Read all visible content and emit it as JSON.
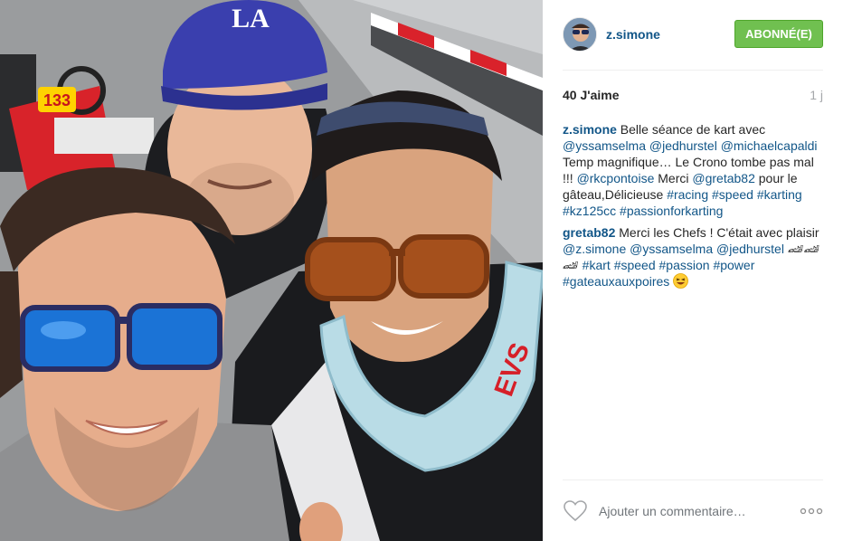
{
  "header": {
    "username": "z.simone",
    "follow_label": "ABONNÉ(E)"
  },
  "stats": {
    "likes": "40 J'aime",
    "time": "1 j"
  },
  "caption": {
    "user": "z.simone",
    "parts": [
      {
        "t": "text",
        "v": " Belle séance de kart avec "
      },
      {
        "t": "tag",
        "v": "@yssamselma"
      },
      {
        "t": "text",
        "v": " "
      },
      {
        "t": "tag",
        "v": "@jedhurstel"
      },
      {
        "t": "text",
        "v": " "
      },
      {
        "t": "tag",
        "v": "@michaelcapaldi"
      },
      {
        "t": "text",
        "v": " Temp magnifique… Le Crono tombe pas mal !!! "
      },
      {
        "t": "tag",
        "v": "@rkcpontoise"
      },
      {
        "t": "text",
        "v": " Merci "
      },
      {
        "t": "tag",
        "v": "@gretab82"
      },
      {
        "t": "text",
        "v": " pour le gâteau,Délicieuse "
      },
      {
        "t": "tag",
        "v": "#racing"
      },
      {
        "t": "text",
        "v": " "
      },
      {
        "t": "tag",
        "v": "#speed"
      },
      {
        "t": "text",
        "v": " "
      },
      {
        "t": "tag",
        "v": "#karting"
      },
      {
        "t": "text",
        "v": " "
      },
      {
        "t": "tag",
        "v": "#kz125cc"
      },
      {
        "t": "text",
        "v": " "
      },
      {
        "t": "tag",
        "v": "#passionforkarting"
      }
    ]
  },
  "reply": {
    "user": "gretab82",
    "parts": [
      {
        "t": "text",
        "v": " Merci les Chefs ! C'était avec plaisir "
      },
      {
        "t": "tag",
        "v": "@z.simone"
      },
      {
        "t": "text",
        "v": " "
      },
      {
        "t": "tag",
        "v": "@yssamselma"
      },
      {
        "t": "text",
        "v": " "
      },
      {
        "t": "tag",
        "v": "@jedhurstel"
      },
      {
        "t": "text",
        "v": " 🏎🏎🏎 "
      },
      {
        "t": "tag",
        "v": "#kart"
      },
      {
        "t": "text",
        "v": " "
      },
      {
        "t": "tag",
        "v": "#speed"
      },
      {
        "t": "text",
        "v": " "
      },
      {
        "t": "tag",
        "v": "#passion"
      },
      {
        "t": "text",
        "v": " "
      },
      {
        "t": "tag",
        "v": "#power"
      },
      {
        "t": "text",
        "v": " "
      },
      {
        "t": "tag",
        "v": "#gateauxauxpoires"
      },
      {
        "t": "text",
        "v": " "
      },
      {
        "t": "emoji",
        "v": "laughing-face"
      }
    ]
  },
  "footer": {
    "comment_placeholder": "Ajouter un commentaire…",
    "like_icon": "heart-outline-icon",
    "more_icon": "more-options-icon"
  },
  "photo": {
    "cap_logo": "LA",
    "kart_number": "133",
    "neck_brace_brand": "EVS"
  },
  "colors": {
    "link": "#125688",
    "follow_button": "#70c050",
    "muted": "#a5a7aa"
  }
}
